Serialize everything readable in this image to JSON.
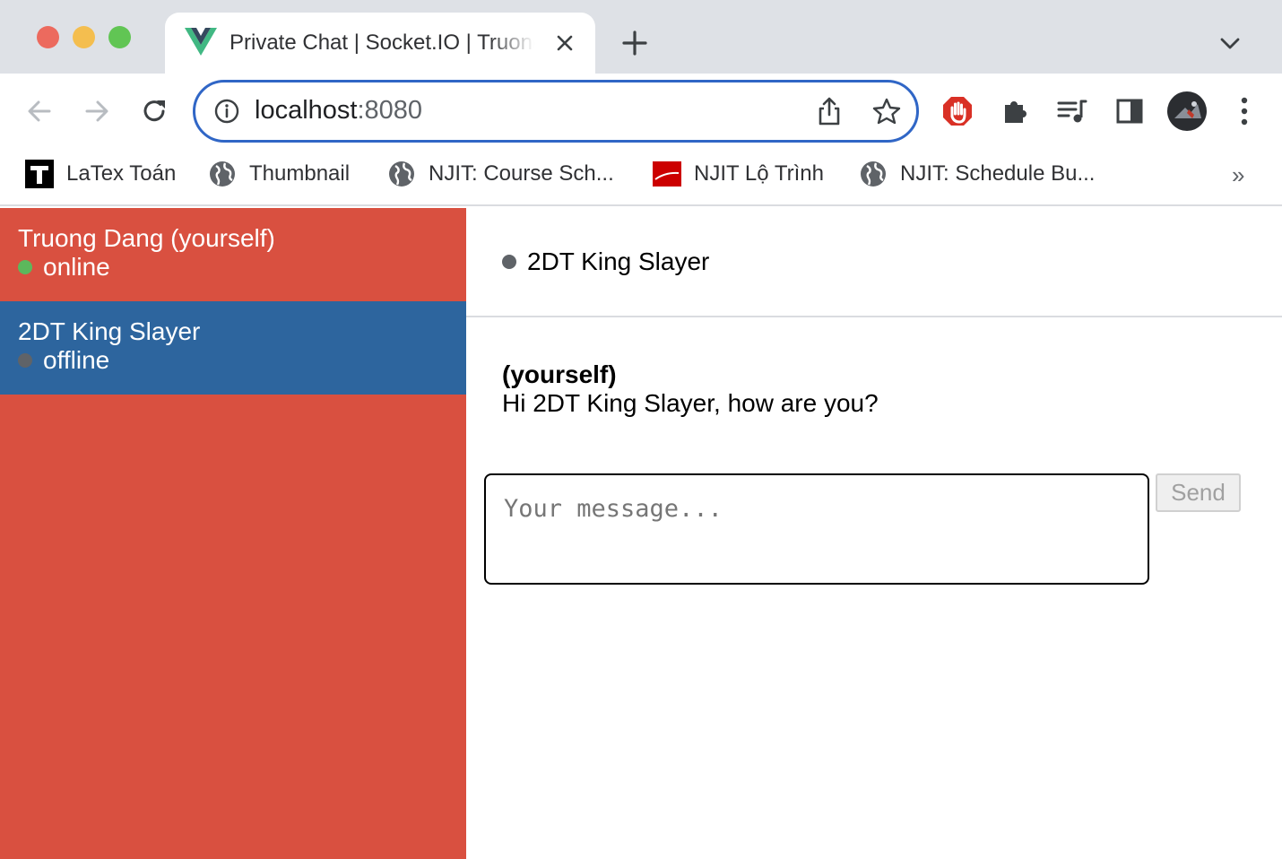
{
  "browser": {
    "tab": {
      "title": "Private Chat | Socket.IO | Truong Dang"
    },
    "address": {
      "host": "localhost",
      "port": ":8080"
    },
    "bookmarks": [
      {
        "label": "LaTex Toán",
        "icon": "latex-t-icon"
      },
      {
        "label": "Thumbnail",
        "icon": "globe-icon"
      },
      {
        "label": "NJIT: Course Sch...",
        "icon": "globe-icon"
      },
      {
        "label": "NJIT Lộ Trình",
        "icon": "njit-red-icon"
      },
      {
        "label": "NJIT: Schedule Bu...",
        "icon": "globe-icon"
      }
    ],
    "bookmarks_more": "»"
  },
  "sidebar": {
    "users": [
      {
        "name": "Truong Dang (yourself)",
        "status": "online",
        "status_color": "#5cb85c",
        "selected": false
      },
      {
        "name": "2DT King Slayer",
        "status": "offline",
        "status_color": "#5f6368",
        "selected": true
      }
    ]
  },
  "chat": {
    "header": {
      "name": "2DT King Slayer"
    },
    "messages": [
      {
        "sender": "(yourself)",
        "content": "Hi 2DT King Slayer, how are you?"
      }
    ],
    "composer": {
      "placeholder": "Your message...",
      "send_label": "Send"
    }
  },
  "colors": {
    "sidebar": "#d95040",
    "selected": "#2d659e",
    "omnibox_border": "#3066c6"
  }
}
